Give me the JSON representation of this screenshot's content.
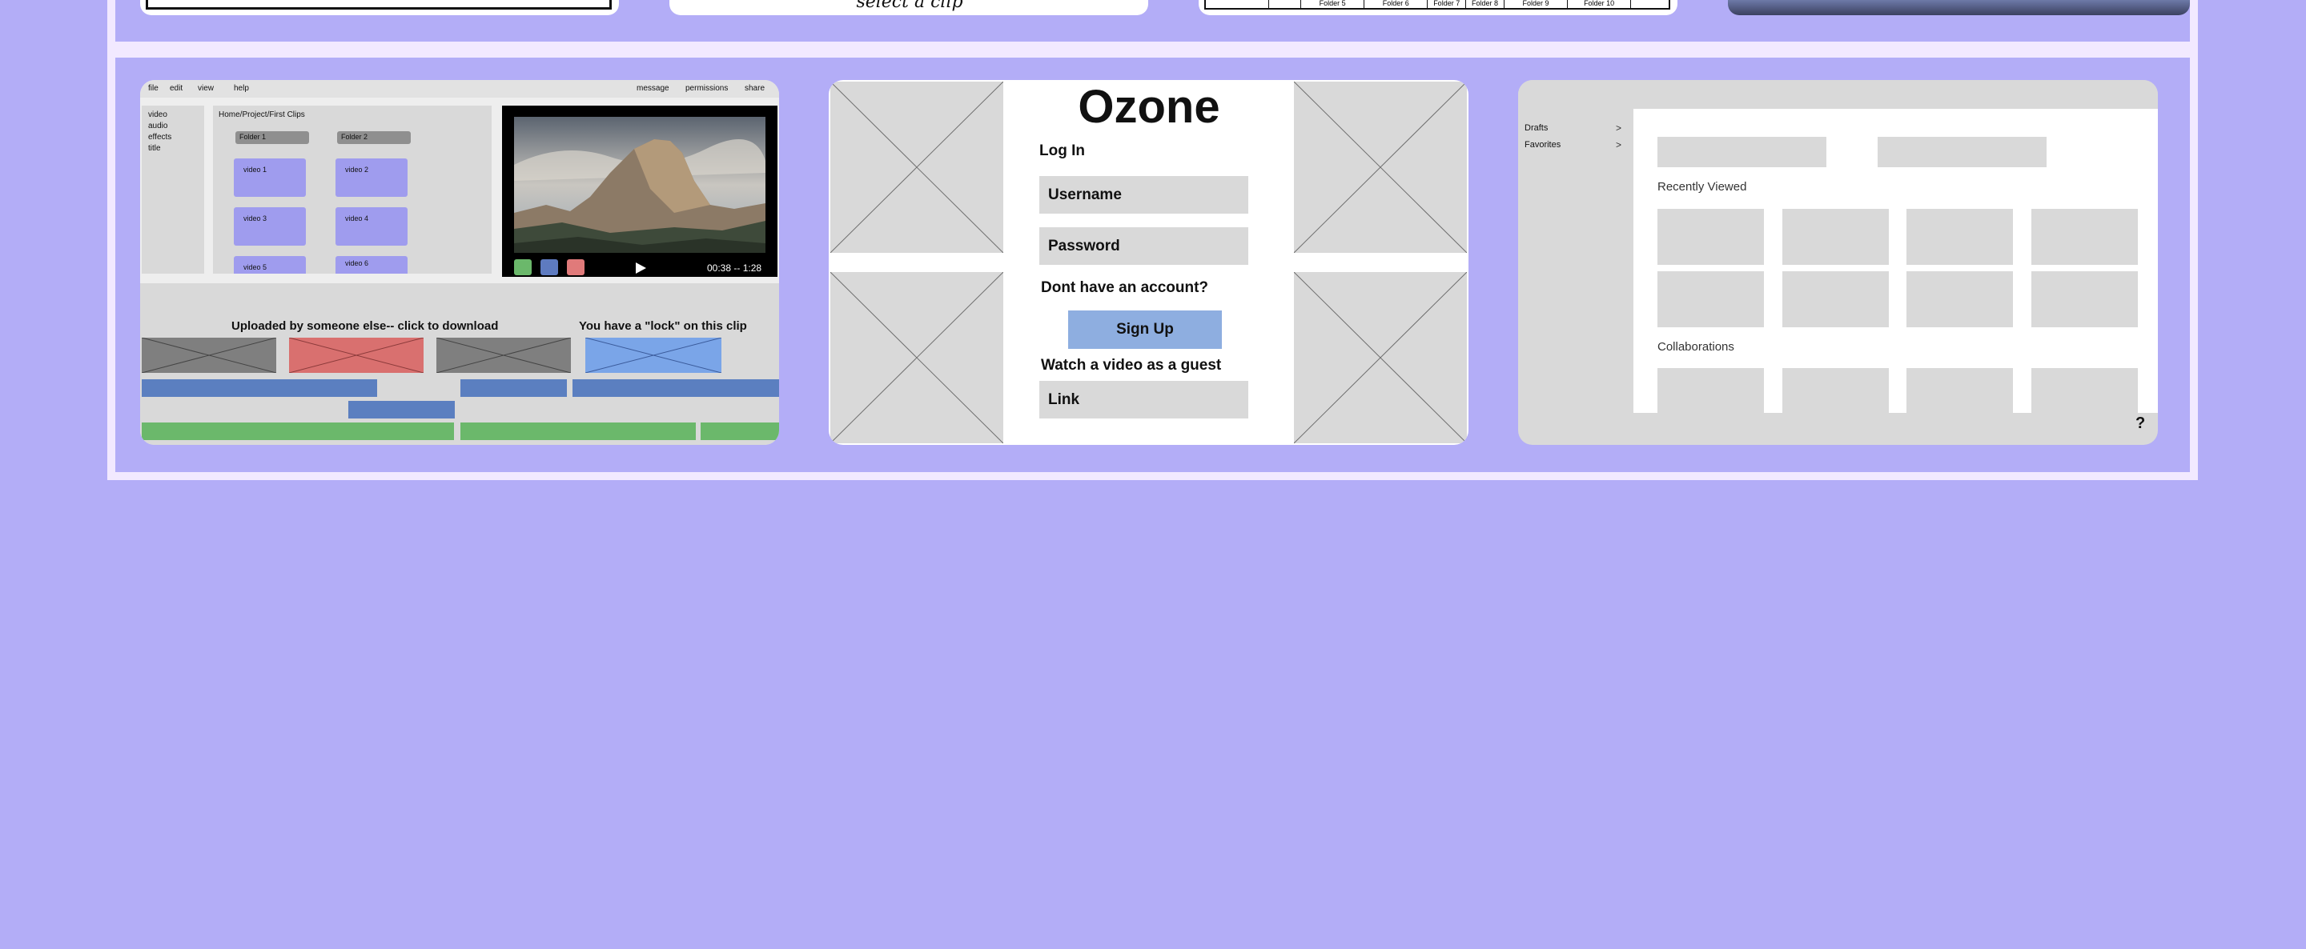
{
  "top_row": {
    "card2_caption": "select a clip",
    "card3_cells": [
      "",
      "",
      "Folder 5",
      "Folder 6",
      "Folder 7",
      "Folder 8",
      "Folder 9",
      "Folder 10",
      ""
    ]
  },
  "editor": {
    "menu": [
      "file",
      "edit",
      "view",
      "help"
    ],
    "right_menu": [
      "message",
      "permissions",
      "share"
    ],
    "sidebar": [
      "video",
      "audio",
      "effects",
      "title"
    ],
    "breadcrumb": "Home/Project/First Clips",
    "folders": [
      "Folder 1",
      "Folder 2"
    ],
    "videos": [
      "video 1",
      "video 2",
      "video 3",
      "video 4",
      "video 5",
      "video 6"
    ],
    "player_time": "00:38 -- 1:28",
    "play_icon": "play-icon",
    "controls_colors": [
      "#6bb86b",
      "#5e7bc0",
      "#e07a7a"
    ],
    "timeline_label_left": "Uploaded by someone else-- click to download",
    "timeline_label_right": "You have a \"lock\" on this clip",
    "clip_colors": {
      "gray": "#7f7f7f",
      "red": "#d9706f",
      "blue": "#7aa5e8",
      "track_blue": "#5b7fc0",
      "track_green": "#6bb86b"
    }
  },
  "login": {
    "title": "Ozone",
    "login_label": "Log In",
    "username_placeholder": "Username",
    "password_placeholder": "Password",
    "no_account": "Dont have an account?",
    "signup": "Sign Up",
    "guest": "Watch a video as a guest",
    "link_placeholder": "Link"
  },
  "dashboard": {
    "sidebar": [
      {
        "label": "Drafts",
        "chevron": ">"
      },
      {
        "label": "Favorites",
        "chevron": ">"
      }
    ],
    "recently_viewed": "Recently Viewed",
    "collaborations": "Collaborations",
    "help": "?"
  }
}
